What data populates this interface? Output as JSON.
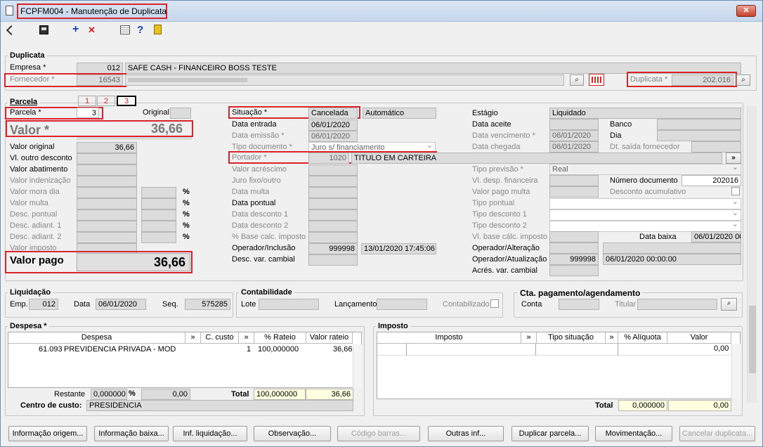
{
  "window": {
    "title": "FCPFM004 - Manutenção de Duplicata",
    "close": "✕"
  },
  "toolbar": {
    "add": "+",
    "delete": "✕",
    "help": "?"
  },
  "duplicata": {
    "title": "Duplicata",
    "empresa_label": "Empresa *",
    "empresa_code": "012",
    "empresa_name": "SAFE CASH - FINANCEIRO BOSS TESTE",
    "fornecedor_label": "Fornecedor *",
    "fornecedor_code": "16543",
    "fornecedor_name": "",
    "duplicata_label": "Duplicata *",
    "duplicata_value": "202.016"
  },
  "parcela": {
    "title": "Parcela",
    "tabs": [
      "1",
      "2",
      "3"
    ],
    "parcela_label": "Parcela *",
    "parcela_value": "3",
    "original_label": "Original",
    "valor_label": "Valor *",
    "valor_value": "36,66",
    "left_fields": [
      {
        "label": "Valor original",
        "value": "36,66",
        "dim": false
      },
      {
        "label": "Vl. outro desconto",
        "value": "",
        "dim": false
      },
      {
        "label": "Valor abatimento",
        "value": "",
        "dim": false
      },
      {
        "label": "Valor indenização",
        "value": "",
        "dim": true
      },
      {
        "label": "Valor mora dia",
        "value": "",
        "dim": true,
        "pct": true
      },
      {
        "label": "Valor multa",
        "value": "",
        "dim": true,
        "pct": true
      },
      {
        "label": "Desc. pontual",
        "value": "",
        "dim": true,
        "pct": true
      },
      {
        "label": "Desc. adiant. 1",
        "value": "",
        "dim": true,
        "pct": true
      },
      {
        "label": "Desc. adiant. 2",
        "value": "",
        "dim": true,
        "pct": true
      },
      {
        "label": "Valor imposto",
        "value": "",
        "dim": true
      }
    ],
    "pct_sign": "%",
    "valor_pago_label": "Valor pago",
    "valor_pago_value": "36,66",
    "situacao_label": "Situação *",
    "situacao_value": "Cancelada",
    "situacao_extra": "Automático",
    "mid_fields": [
      {
        "label": "Data entrada",
        "value": "06/01/2020",
        "dim": false
      },
      {
        "label": "Data emissão *",
        "value": "06/01/2020",
        "dim": true
      },
      {
        "label": "Tipo documento *",
        "value": "Juro s/ financiamento",
        "dim": true
      }
    ],
    "portador_label": "Portador *",
    "portador_code": "1020",
    "portador_name": "TITULO EM CARTEIRA",
    "mid_fields2": [
      {
        "label": "Valor acréscimo",
        "dim": true
      },
      {
        "label": "Juro fixo/outro",
        "dim": true
      },
      {
        "label": "Data multa",
        "dim": true
      },
      {
        "label": "Data pontual",
        "dim": false
      },
      {
        "label": "Data desconto 1",
        "dim": true
      },
      {
        "label": "Data desconto 2",
        "dim": true
      },
      {
        "label": "% Base calc. imposto",
        "dim": true
      }
    ],
    "operador_inclusao_label": "Operador/Inclusão",
    "operador_inclusao_code": "999998",
    "operador_inclusao_date": "13/01/2020 17:45:06",
    "desc_var_label": "Desc. var. cambial",
    "estagio_label": "Estágio",
    "estagio_value": "Liquidado",
    "data_aceite_label": "Data aceite",
    "banco_label": "Banco",
    "dia_label": "Dia",
    "data_venc_label": "Data vencimento *",
    "data_venc_value": "06/01/2020",
    "data_chegada_label": "Data chegada",
    "data_chegada_value": "06/01/2020",
    "dt_saida_label": "Dt. saída fornecedor",
    "tipo_previsao_label": "Tipo previsão *",
    "tipo_previsao_value": "Real",
    "vl_desp_label": "Vl. desp. financeira",
    "num_doc_label": "Número documento",
    "num_doc_value": "202016",
    "valor_pago_multa_label": "Valor pago multa",
    "desconto_acum_label": "Desconto acumulativo",
    "right_dd": [
      "Tipo pontual",
      "Tipo desconto 1",
      "Tipo desconto 2"
    ],
    "vl_base_label": "Vl. base cálc. imposto",
    "data_baixa_label": "Data baixa",
    "data_baixa_value": "06/01/2020 00",
    "operador_alt_label": "Operador/Alteração",
    "operador_atu_label": "Operador/Atualização",
    "operador_atu_code": "999998",
    "operador_atu_date": "06/01/2020 00:00:00",
    "acres_label": "Acrés. var. cambial"
  },
  "liquidacao": {
    "title": "Liquidação",
    "emp_label": "Emp.",
    "emp_value": "012",
    "data_label": "Data",
    "data_value": "06/01/2020",
    "seq_label": "Seq.",
    "seq_value": "575285"
  },
  "contabilidade": {
    "title": "Contabilidade",
    "lote_label": "Lote",
    "lanc_label": "Lançamento",
    "contab_label": "Contabilizado"
  },
  "cta": {
    "title": "Cta. pagamento/agendamento",
    "conta_label": "Conta",
    "titular_label": "Titular"
  },
  "despesa": {
    "title": "Despesa *",
    "headers": [
      "Despesa",
      "C. custo",
      "% Rateio",
      "Valor rateio"
    ],
    "rows": [
      {
        "code": "61.093",
        "desc": "PREVIDENCIA PRIVADA - MOD",
        "ccusto": "1",
        "rateio": "100,000000",
        "valor": "36,66"
      }
    ],
    "restante_label": "Restante",
    "restante_pct": "0,000000",
    "pct_sign": "%",
    "restante_val": "0,00",
    "total_label": "Total",
    "total_pct": "100,000000",
    "total_val": "36,66",
    "centro_label": "Centro de custo:",
    "centro_value": "PRESIDENCIA"
  },
  "imposto": {
    "title": "Imposto",
    "headers": [
      "Imposto",
      "Tipo situação",
      "% Alíquota",
      "Valor"
    ],
    "row_valor": "0,00",
    "total_label": "Total",
    "total_pct": "0,000000",
    "total_val": "0,00"
  },
  "buttons": [
    {
      "label": "Informação origem...",
      "enabled": true
    },
    {
      "label": "Informação baixa...",
      "enabled": true
    },
    {
      "label": "Inf. liquidação...",
      "enabled": true
    },
    {
      "label": "Observação...",
      "enabled": true
    },
    {
      "label": "Código barras...",
      "enabled": false
    },
    {
      "label": "Outras inf...",
      "enabled": true
    },
    {
      "label": "Duplicar parcela...",
      "enabled": true
    },
    {
      "label": "Movimentação...",
      "enabled": true
    },
    {
      "label": "Cancelar duplicata...",
      "enabled": false
    }
  ]
}
